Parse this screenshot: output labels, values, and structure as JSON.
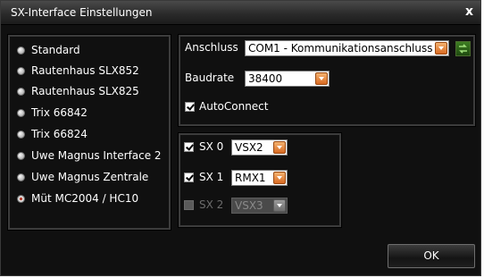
{
  "window": {
    "title": "SX-Interface Einstellungen",
    "close_glyph": "x"
  },
  "interfaces": {
    "selected_index": 7,
    "items": [
      "Standard",
      "Rautenhaus SLX852",
      "Rautenhaus SLX825",
      "Trix 66842",
      "Trix 66824",
      "Uwe Magnus Interface 2",
      "Uwe Magnus Zentrale",
      "Müt MC2004 / HC10"
    ]
  },
  "connection": {
    "port_label": "Anschluss",
    "port_value": "COM1 - Kommunikationsanschluss (",
    "baud_label": "Baudrate",
    "baud_value": "38400",
    "autoconnect_label": "AutoConnect",
    "autoconnect_checked": true,
    "refresh_icon": "refresh-icon"
  },
  "sx": {
    "rows": [
      {
        "label": "SX 0",
        "checked": true,
        "value": "VSX2",
        "enabled": true
      },
      {
        "label": "SX 1",
        "checked": true,
        "value": "RMX1",
        "enabled": true
      },
      {
        "label": "SX 2",
        "checked": false,
        "value": "VSX3",
        "enabled": false
      }
    ]
  },
  "buttons": {
    "ok_label": "OK"
  },
  "colors": {
    "dialog_bg": "#101010",
    "accent_dropdown": "#d86a22",
    "panel_border": "#3c3c3c"
  }
}
